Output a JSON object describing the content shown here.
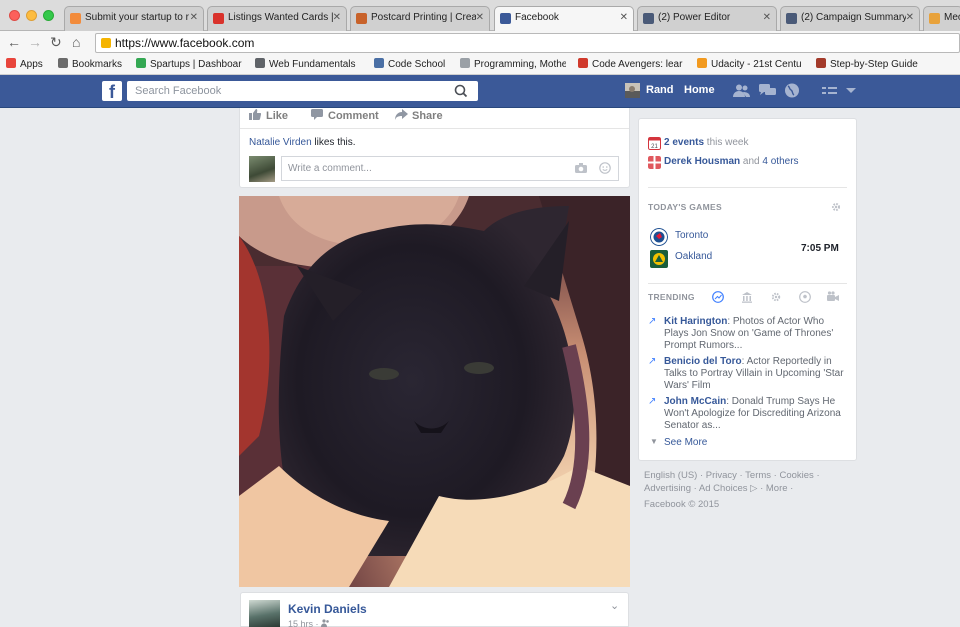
{
  "browser": {
    "tabs": [
      {
        "title": "Submit your startup to r",
        "favicon_color": "#f28b3b",
        "active": false
      },
      {
        "title": "Listings Wanted Cards |",
        "favicon_color": "#d9322b",
        "active": false
      },
      {
        "title": "Postcard Printing | Creat",
        "favicon_color": "#c8622a",
        "active": false
      },
      {
        "title": "Facebook",
        "favicon_color": "#3b5998",
        "active": true
      },
      {
        "title": "(2) Power Editor",
        "favicon_color": "#4a5a78",
        "active": false
      },
      {
        "title": "(2) Campaign Summary",
        "favicon_color": "#4a5a78",
        "active": false
      },
      {
        "title": "Meo",
        "favicon_color": "#e8a23b",
        "active": false
      }
    ],
    "url": "https://www.facebook.com",
    "bookmarks": [
      {
        "label": "Apps",
        "color": "#e8453c"
      },
      {
        "label": "Bookmarks",
        "color": "#6b6b6b"
      },
      {
        "label": "Spartups | Dashboar",
        "color": "#34a853"
      },
      {
        "label": "Web Fundamentals |",
        "color": "#5f6368"
      },
      {
        "label": "Code School",
        "color": "#4a6fa5"
      },
      {
        "label": "Programming, Mothe",
        "color": "#9aa0a6"
      },
      {
        "label": "Code Avengers: lear",
        "color": "#d0392b"
      },
      {
        "label": "Udacity - 21st Centu",
        "color": "#f29a1f"
      },
      {
        "label": "Step-by-Step Guide",
        "color": "#a33a2a"
      }
    ]
  },
  "fb": {
    "logo": "f",
    "search_placeholder": "Search Facebook",
    "user_name": "Rand",
    "home_label": "Home"
  },
  "post1": {
    "like_label": "Like",
    "comment_label": "Comment",
    "share_label": "Share",
    "liker_name": "Natalie Virden",
    "likes_suffix": " likes this.",
    "comment_placeholder": "Write a comment..."
  },
  "post2": {
    "author": "Kevin Daniels",
    "time": "15 hrs ·"
  },
  "sidebar": {
    "events_count": "2 events",
    "events_suffix": " this week",
    "birthday_name": "Derek Housman",
    "birthday_and": " and ",
    "birthday_others": "4 others",
    "calendar_day": "21",
    "games_heading": "TODAY'S GAMES",
    "team1": "Toronto",
    "team2": "Oakland",
    "game_time": "7:05 PM",
    "trending_heading": "TRENDING",
    "trends": [
      {
        "name": "Kit Harington",
        "desc": ": Photos of Actor Who Plays Jon Snow on 'Game of Thrones' Prompt Rumors..."
      },
      {
        "name": "Benicio del Toro",
        "desc": ": Actor Reportedly in Talks to Portray Villain in Upcoming 'Star Wars' Film"
      },
      {
        "name": "John McCain",
        "desc": ": Donald Trump Says He Won't Apologize for Discrediting Arizona Senator as..."
      }
    ],
    "see_more": "See More"
  },
  "footer": {
    "line1": "English (US) · Privacy · Terms · Cookies ·",
    "line2": "Advertising · Ad Choices",
    "more": " · More ·",
    "copyright": "Facebook © 2015"
  },
  "colors": {
    "fb_blue": "#3b5998",
    "link_blue": "#365899",
    "page_bg": "#e9ebee"
  }
}
